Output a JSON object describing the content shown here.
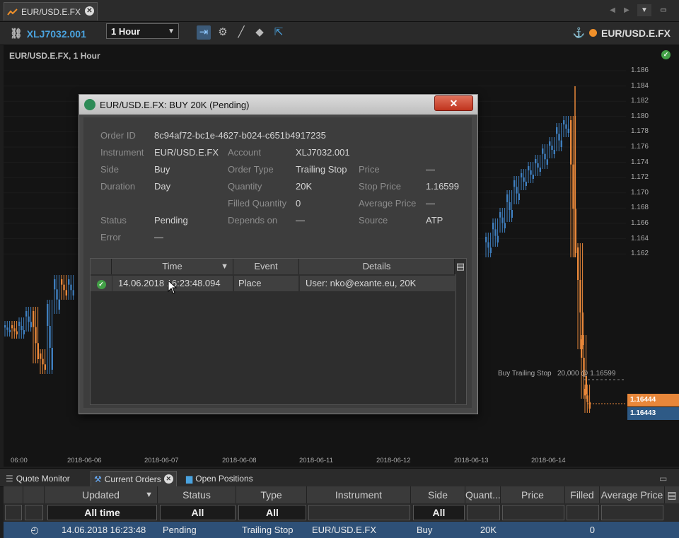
{
  "window": {
    "tab_title": "EUR/USD.E.FX"
  },
  "toolbar": {
    "account": "XLJ7032.001",
    "timeframe": "1 Hour",
    "instrument": "EUR/USD.E.FX"
  },
  "chart": {
    "title": "EUR/USD.E.FX, 1 Hour",
    "y_ticks": [
      "1.186",
      "1.184",
      "1.182",
      "1.180",
      "1.178",
      "1.176",
      "1.174",
      "1.172",
      "1.170",
      "1.168",
      "1.166",
      "1.164",
      "1.162"
    ],
    "x_ticks": [
      "06:00",
      "2018-06-06",
      "2018-06-07",
      "2018-06-08",
      "2018-06-11",
      "2018-06-12",
      "2018-06-13",
      "2018-06-14"
    ],
    "order_line_label": "Buy Trailing Stop",
    "order_line_value": "20,000 @ 1.16599",
    "price_ask": "1.16444",
    "price_bid": "1.16443",
    "colors": {
      "up": "#3f7fbf",
      "down": "#e8873a",
      "ask_tag": "#e8873a",
      "bid_tag": "#2e5a86"
    }
  },
  "dialog": {
    "title": "EUR/USD.E.FX: BUY 20K (Pending)",
    "close": "✕",
    "fields": {
      "order_id_label": "Order ID",
      "order_id": "8c94af72-bc1e-4627-b024-c651b4917235",
      "instrument_label": "Instrument",
      "instrument": "EUR/USD.E.FX",
      "account_label": "Account",
      "account": "XLJ7032.001",
      "side_label": "Side",
      "side": "Buy",
      "order_type_label": "Order Type",
      "order_type": "Trailing Stop",
      "price_label": "Price",
      "price": "—",
      "duration_label": "Duration",
      "duration": "Day",
      "quantity_label": "Quantity",
      "quantity": "20K",
      "stop_price_label": "Stop Price",
      "stop_price": "1.16599",
      "filled_qty_label": "Filled Quantity",
      "filled_qty": "0",
      "avg_price_label": "Average Price",
      "avg_price": "—",
      "status_label": "Status",
      "status": "Pending",
      "depends_on_label": "Depends on",
      "depends_on": "—",
      "source_label": "Source",
      "source": "ATP",
      "error_label": "Error",
      "error": "—"
    },
    "events": {
      "headers": {
        "time": "Time",
        "event": "Event",
        "details": "Details"
      },
      "rows": [
        {
          "time": "14.06.2018 16:23:48.094",
          "event": "Place",
          "details": "User: nko@exante.eu, 20K"
        }
      ]
    }
  },
  "bottom_tabs": [
    "Quote Monitor",
    "Current Orders",
    "Open Positions"
  ],
  "orders": {
    "headers": {
      "updated": "Updated",
      "status": "Status",
      "type": "Type",
      "instrument": "Instrument",
      "side": "Side",
      "quantity": "Quant...",
      "price": "Price",
      "filled": "Filled",
      "avg_price": "Average Price"
    },
    "filters": {
      "updated": "All time",
      "status": "All",
      "type": "All",
      "side": "All"
    },
    "rows": [
      {
        "updated": "14.06.2018 16:23:48",
        "status": "Pending",
        "type": "Trailing Stop",
        "instrument": "EUR/USD.E.FX",
        "side": "Buy",
        "quantity": "20K",
        "price": "",
        "filled": "0",
        "avg_price": ""
      }
    ]
  }
}
